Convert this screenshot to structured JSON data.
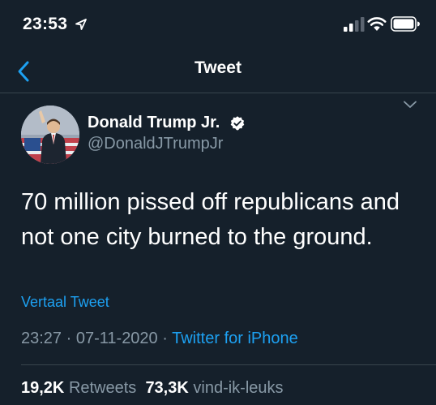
{
  "status_bar": {
    "time": "23:53",
    "icons": [
      "location-arrow-icon",
      "signal-icon",
      "wifi-icon",
      "battery-icon"
    ]
  },
  "nav": {
    "title": "Tweet",
    "back_icon": "chevron-left-icon"
  },
  "tweet": {
    "author_name": "Donald Trump Jr.",
    "verified": true,
    "handle": "@DonaldJTrumpJr",
    "text": "70 million pissed off republicans and not one city burned to the ground.",
    "translate_label": "Vertaal Tweet",
    "time": "23:27",
    "separator": "·",
    "date": "07-11-2020",
    "source": "Twitter for iPhone",
    "retweets_count": "19,2K",
    "retweets_label": "Retweets",
    "likes_count": "73,3K",
    "likes_label": "vind-ik-leuks"
  },
  "colors": {
    "background": "#15202b",
    "accent": "#1da1f2",
    "secondary_text": "#8899a6",
    "divider": "#38444d"
  }
}
